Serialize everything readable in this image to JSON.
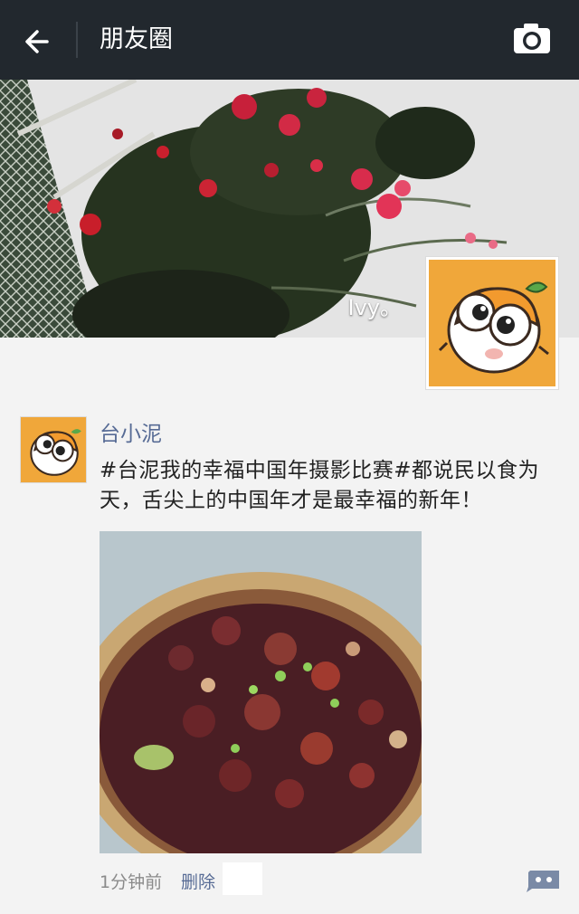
{
  "header": {
    "title": "朋友圈",
    "back_icon": "arrow-left-icon",
    "camera_icon": "camera-icon",
    "background": "#22282e"
  },
  "cover": {
    "nickname": "Ivy。"
  },
  "post": {
    "author": "台小泥",
    "text": "#台泥我的幸福中国年摄影比赛#都说民以食为天，舌尖上的中国年才是最幸福的新年！",
    "time": "1分钟前",
    "delete_label": "删除",
    "comment_icon": "comment-bubble-icon"
  },
  "colors": {
    "link": "#576b95",
    "avatar_bg": "#f0b23a"
  }
}
